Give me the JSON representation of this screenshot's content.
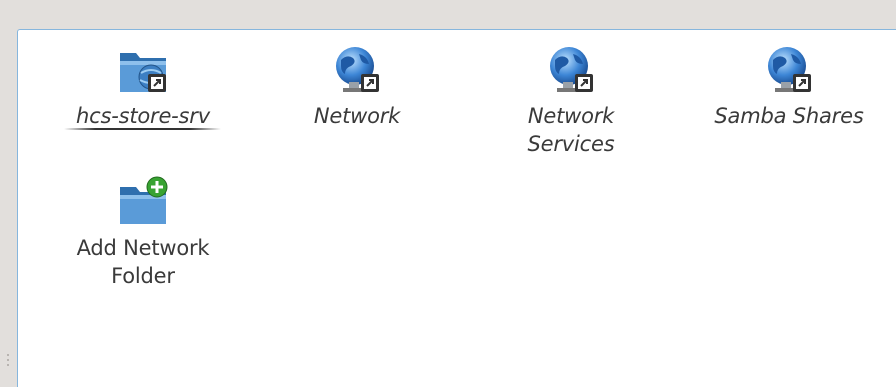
{
  "network_view": {
    "items": [
      {
        "label": "hcs-store-srv",
        "icon": "folder-remote-link-icon",
        "type": "shortcut",
        "selected": true
      },
      {
        "label": "Network",
        "icon": "globe-link-icon",
        "type": "shortcut"
      },
      {
        "label": "Network",
        "label_line2": "Services",
        "icon": "globe-link-icon",
        "type": "shortcut"
      },
      {
        "label": "Samba Shares",
        "icon": "globe-link-icon",
        "type": "shortcut"
      },
      {
        "label": "Add Network",
        "label_line2": "Folder",
        "icon": "folder-add-icon",
        "type": "action"
      }
    ]
  },
  "colors": {
    "window_bg": "#e2dfdc",
    "panel_bg": "#ffffff",
    "panel_border": "#86b6dd",
    "text": "#3a3a3a",
    "folder_blue": "#4b8ed0",
    "add_green": "#38a332"
  }
}
